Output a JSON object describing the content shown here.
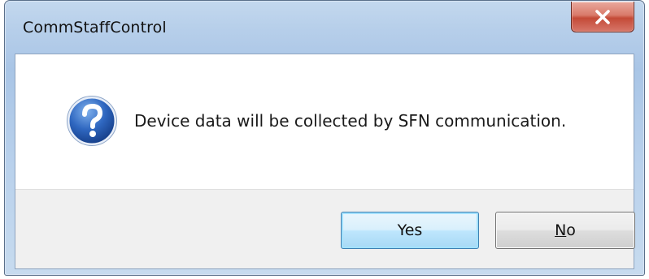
{
  "window": {
    "title": "CommStaffControl",
    "close_icon": "close-icon"
  },
  "message": {
    "icon": "question-icon",
    "text": "Device data will be collected by SFN communication."
  },
  "buttons": {
    "yes_label": "Yes",
    "no_label": "No"
  },
  "colors": {
    "close_button": "#c44a37",
    "question_icon": "#2a5fb0",
    "default_button_border": "#3c7fb1"
  }
}
